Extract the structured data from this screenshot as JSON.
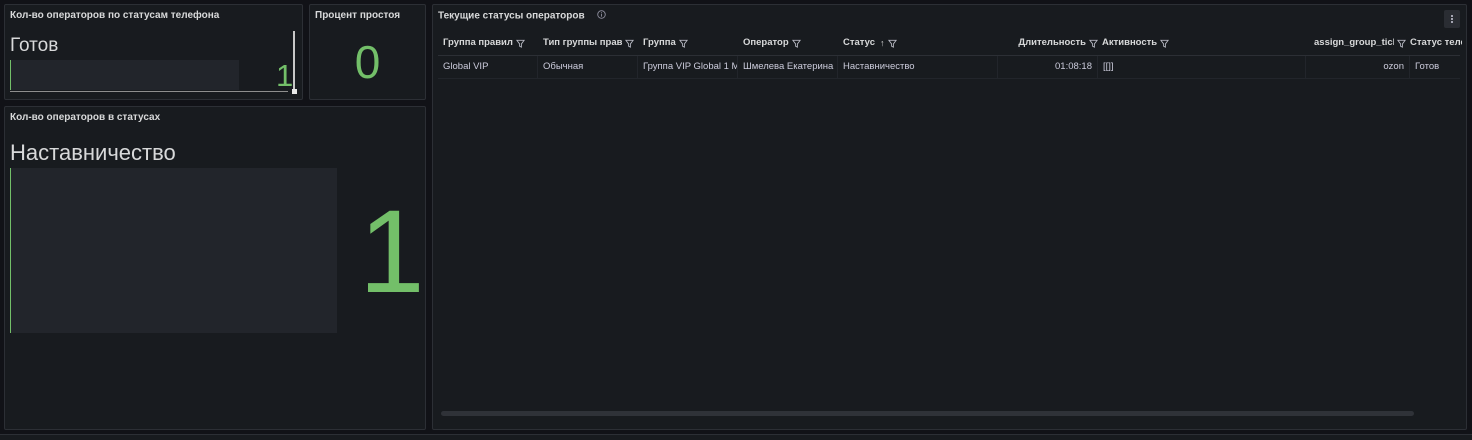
{
  "panels": {
    "phone_status": {
      "title": "Кол-во операторов по статусам телефона",
      "label": "Готов",
      "value": "1"
    },
    "idle_percent": {
      "title": "Процент простоя",
      "value": "0"
    },
    "operators_in_status": {
      "title": "Кол-во операторов в статусах",
      "label": "Наставничество",
      "value": "1"
    },
    "current_statuses": {
      "title": "Текущие статусы операторов",
      "info_icon": "info-icon",
      "menu_icon": "kebab-menu-icon",
      "columns": [
        {
          "label": "Группа правил"
        },
        {
          "label": "Тип группы прав"
        },
        {
          "label": "Группа"
        },
        {
          "label": "Оператор"
        },
        {
          "label": "Статус",
          "sort": "↑"
        },
        {
          "label": "Длительность"
        },
        {
          "label": "Активность"
        },
        {
          "label": "assign_group_ticl"
        },
        {
          "label": "Статус теле"
        }
      ],
      "rows": [
        [
          "Global VIP",
          "Обычная",
          "Группа VIP Global 1 M",
          "Шмелева Екатерина",
          "Наставничество",
          "01:08:18",
          "[[]]",
          "ozon",
          "Готов"
        ]
      ]
    }
  },
  "colors": {
    "accent_green": "#73bf69",
    "panel_bg": "#181b1f",
    "page_bg": "#111217"
  }
}
